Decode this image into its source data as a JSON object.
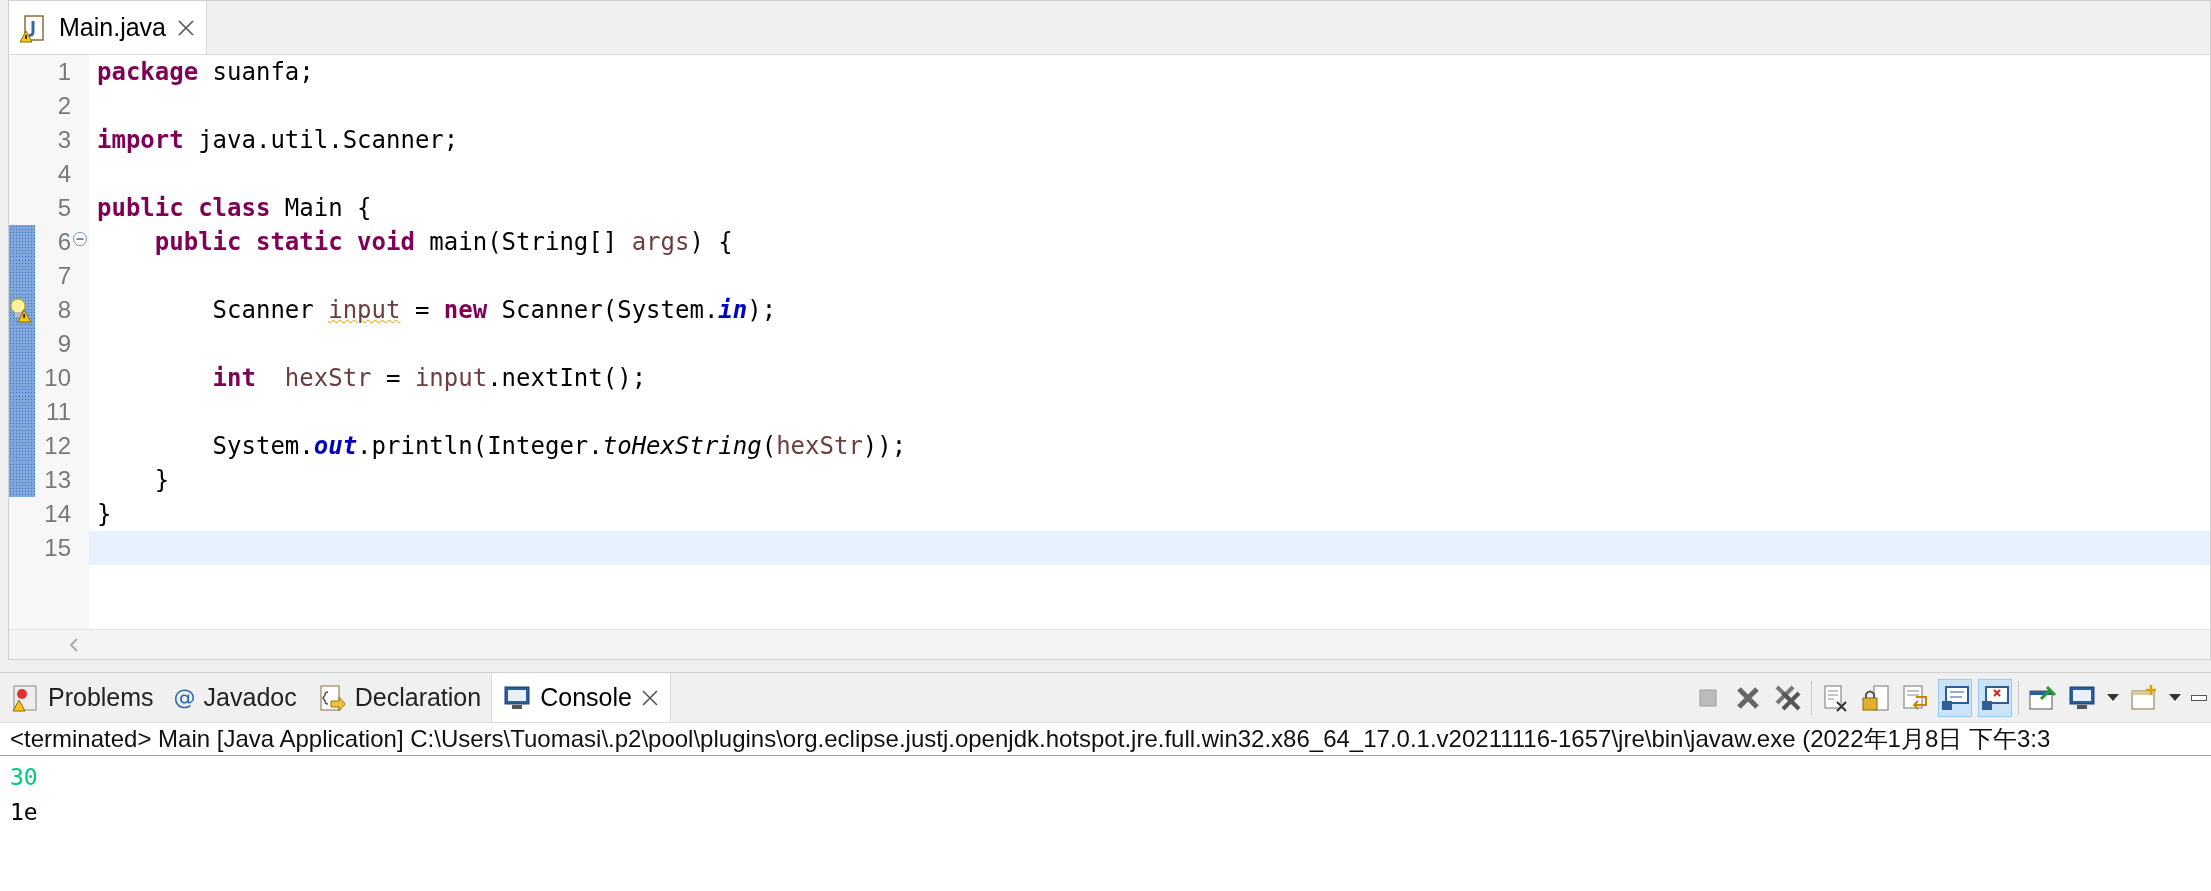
{
  "editor": {
    "tabs": [
      {
        "label": "Main.java",
        "selected": true,
        "has_warning": true
      }
    ],
    "lines": [
      {
        "number": "1",
        "changed": false,
        "fold_toggle": false,
        "warning": false,
        "current": false,
        "segments": [
          {
            "text": "package",
            "kind": "keyword"
          },
          {
            "text": " suanfa;",
            "kind": "plain"
          }
        ]
      },
      {
        "number": "2",
        "changed": false,
        "fold_toggle": false,
        "warning": false,
        "current": false
      },
      {
        "number": "3",
        "changed": false,
        "fold_toggle": false,
        "warning": false,
        "current": false,
        "segments": [
          {
            "text": "import",
            "kind": "keyword"
          },
          {
            "text": " java.util.Scanner;",
            "kind": "plain"
          }
        ]
      },
      {
        "number": "4",
        "changed": false,
        "fold_toggle": false,
        "warning": false,
        "current": false
      },
      {
        "number": "5",
        "changed": false,
        "fold_toggle": false,
        "warning": false,
        "current": false,
        "segments": [
          {
            "text": "public",
            "kind": "keyword"
          },
          {
            "text": " class",
            "kind": "keyword"
          },
          {
            "text": " Main {",
            "kind": "plain"
          }
        ]
      },
      {
        "number": "6",
        "changed": true,
        "fold_toggle": true,
        "warning": false,
        "current": false,
        "segments": [
          {
            "text": "    public",
            "kind": "keyword"
          },
          {
            "text": " static",
            "kind": "keyword"
          },
          {
            "text": " void",
            "kind": "keyword"
          },
          {
            "text": " main(String[] ",
            "kind": "plain"
          },
          {
            "text": "args",
            "kind": "local"
          },
          {
            "text": ") {",
            "kind": "plain"
          }
        ]
      },
      {
        "number": "7",
        "changed": true,
        "fold_toggle": false,
        "warning": false,
        "current": false
      },
      {
        "number": "8",
        "changed": true,
        "fold_toggle": false,
        "warning": true,
        "current": false,
        "segments": [
          {
            "text": "        Scanner ",
            "kind": "plain"
          },
          {
            "text": "input",
            "kind": "warning"
          },
          {
            "text": " = ",
            "kind": "plain"
          },
          {
            "text": "new",
            "kind": "keyword"
          },
          {
            "text": " Scanner(System.",
            "kind": "plain"
          },
          {
            "text": "in",
            "kind": "static_field"
          },
          {
            "text": ");",
            "kind": "plain"
          }
        ]
      },
      {
        "number": "9",
        "changed": true,
        "fold_toggle": false,
        "warning": false,
        "current": false
      },
      {
        "number": "10",
        "changed": true,
        "fold_toggle": false,
        "warning": false,
        "current": false,
        "segments": [
          {
            "text": "        int",
            "kind": "keyword"
          },
          {
            "text": "  hexStr",
            "kind": "local"
          },
          {
            "text": " = ",
            "kind": "plain"
          },
          {
            "text": "input",
            "kind": "local"
          },
          {
            "text": ".nextInt();",
            "kind": "plain"
          }
        ]
      },
      {
        "number": "11",
        "changed": true,
        "fold_toggle": false,
        "warning": false,
        "current": false
      },
      {
        "number": "12",
        "changed": true,
        "fold_toggle": false,
        "warning": false,
        "current": false,
        "segments": [
          {
            "text": "        System.",
            "kind": "plain"
          },
          {
            "text": "out",
            "kind": "static_field"
          },
          {
            "text": ".println(Integer.",
            "kind": "plain"
          },
          {
            "text": "toHexString",
            "kind": "static_method"
          },
          {
            "text": "(",
            "kind": "plain"
          },
          {
            "text": "hexStr",
            "kind": "local"
          },
          {
            "text": "));",
            "kind": "plain"
          }
        ]
      },
      {
        "number": "13",
        "changed": true,
        "fold_toggle": false,
        "warning": false,
        "current": false,
        "segments": [
          {
            "text": "    }",
            "kind": "plain"
          }
        ]
      },
      {
        "number": "14",
        "changed": false,
        "fold_toggle": false,
        "warning": false,
        "current": false,
        "segments": [
          {
            "text": "}",
            "kind": "plain"
          }
        ]
      },
      {
        "number": "15",
        "changed": false,
        "fold_toggle": false,
        "warning": false,
        "current": true
      }
    ]
  },
  "console_panel": {
    "tabs": [
      {
        "label": "Problems",
        "kind": "problems",
        "selected": false
      },
      {
        "label": "Javadoc",
        "kind": "javadoc",
        "icon_text": "@",
        "selected": false
      },
      {
        "label": "Declaration",
        "kind": "declaration",
        "selected": false
      },
      {
        "label": "Console",
        "kind": "console",
        "selected": true
      }
    ],
    "toolbar": [
      {
        "kind": "terminate",
        "disabled": true
      },
      {
        "kind": "remove"
      },
      {
        "kind": "remove_all"
      },
      {
        "kind": "separator"
      },
      {
        "kind": "clear"
      },
      {
        "kind": "scroll_lock",
        "selected": false
      },
      {
        "kind": "word_wrap",
        "selected": false
      },
      {
        "kind": "show_stdout",
        "selected": true
      },
      {
        "kind": "show_stderr",
        "selected": true
      },
      {
        "kind": "separator"
      },
      {
        "kind": "pin",
        "selected": false
      },
      {
        "kind": "display"
      },
      {
        "kind": "dropdown"
      },
      {
        "kind": "new_console"
      },
      {
        "kind": "dropdown"
      },
      {
        "kind": "minimize"
      }
    ],
    "header": "<terminated> Main [Java Application] C:\\Users\\Tuomasi\\.p2\\pool\\plugins\\org.eclipse.justj.openjdk.hotspot.jre.full.win32.x86_64_17.0.1.v20211116-1657\\jre\\bin\\javaw.exe  (2022年1月8日 下午3:3",
    "output": [
      {
        "text": "30",
        "kind": "input"
      },
      {
        "text": "1e",
        "kind": "output"
      }
    ]
  }
}
